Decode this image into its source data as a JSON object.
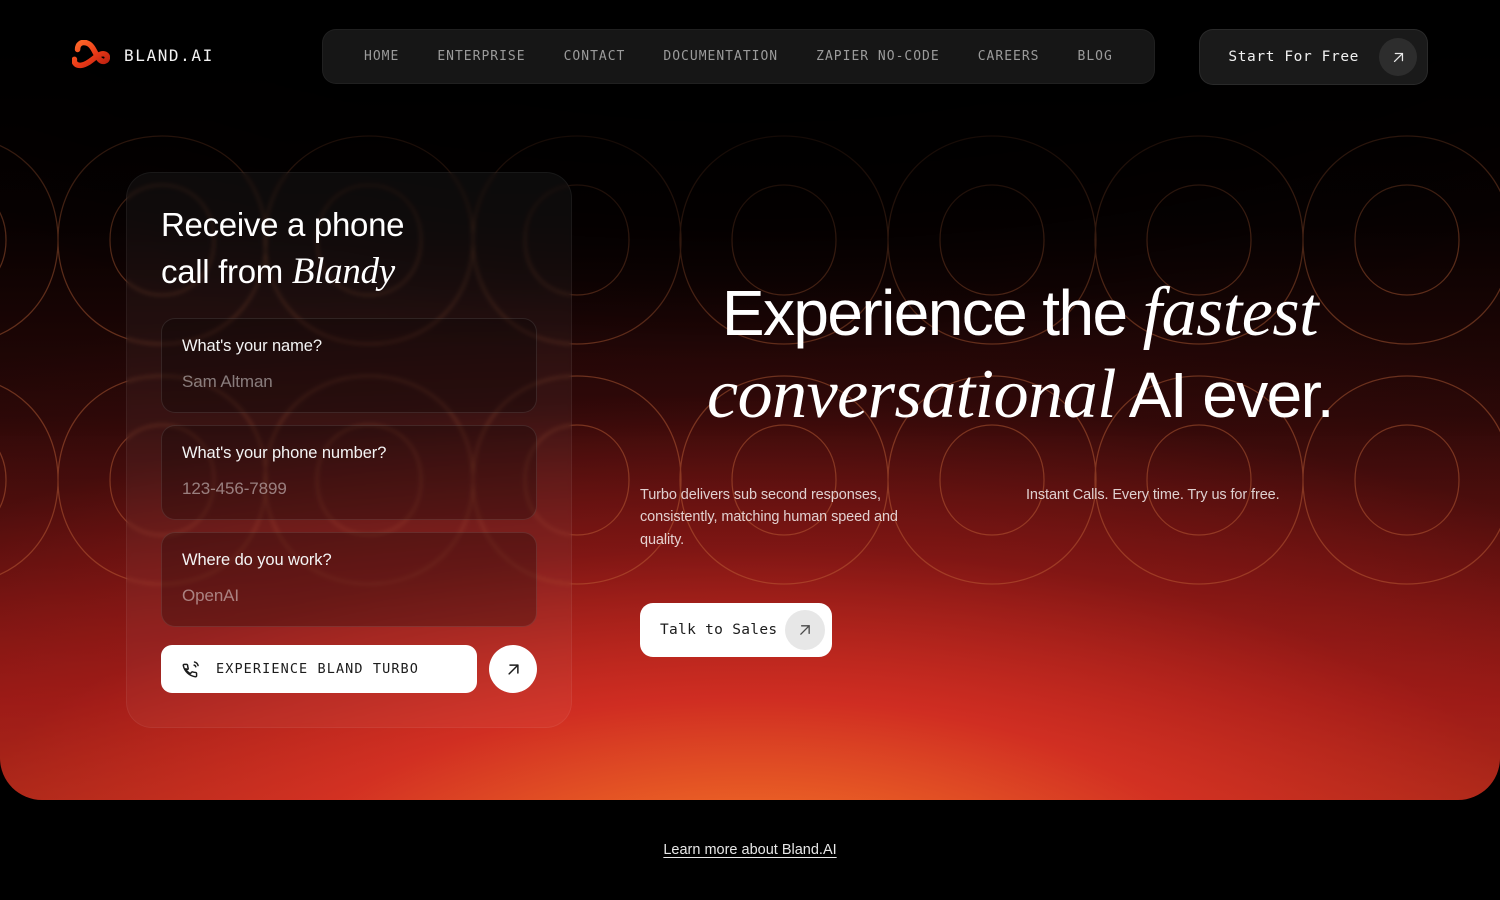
{
  "brand": {
    "name": "BLAND.AI",
    "logo_icon": "infinity-loop-icon",
    "accent_color": "#e8491f"
  },
  "nav": {
    "items": [
      {
        "label": "HOME"
      },
      {
        "label": "ENTERPRISE"
      },
      {
        "label": "CONTACT"
      },
      {
        "label": "DOCUMENTATION"
      },
      {
        "label": "ZAPIER NO-CODE"
      },
      {
        "label": "CAREERS"
      },
      {
        "label": "BLOG"
      }
    ]
  },
  "header_cta": {
    "label": "Start For Free",
    "icon": "arrow-up-right-icon"
  },
  "call_card": {
    "title_line1": "Receive a phone",
    "title_line2": "call from ",
    "title_italic": "Blandy",
    "fields": [
      {
        "label": "What's your name?",
        "value": "Sam Altman"
      },
      {
        "label": "What's your phone number?",
        "value": "123-456-7899"
      },
      {
        "label": "Where do you work?",
        "value": "OpenAI"
      }
    ],
    "submit": {
      "label": "EXPERIENCE BLAND TURBO",
      "phone_icon": "phone-ringing-icon",
      "arrow_icon": "arrow-up-right-icon"
    }
  },
  "hero": {
    "headline_part1": "Experience the ",
    "headline_italic1": "fastest",
    "headline_italic2": "conversational",
    "headline_part2": " AI ever.",
    "sub_left": "Turbo delivers sub second responses, consistently, matching human speed and quality.",
    "sub_right": "Instant Calls. Every time. Try us for free.",
    "sales_button": {
      "label": "Talk to Sales",
      "icon": "arrow-up-right-icon"
    }
  },
  "footer": {
    "link_label": "Learn more about Bland.AI"
  }
}
